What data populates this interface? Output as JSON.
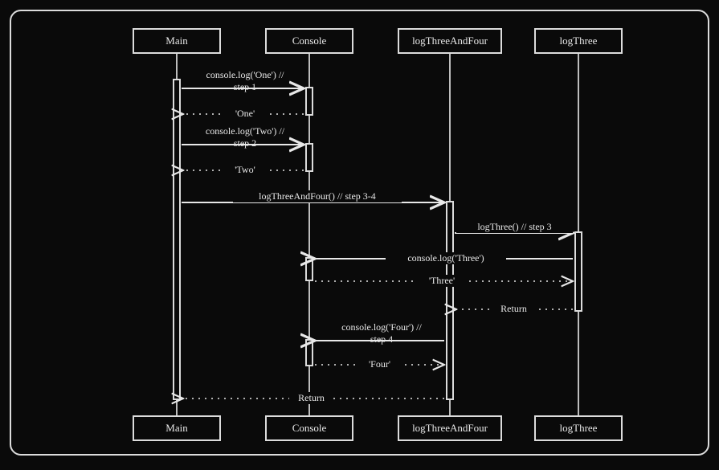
{
  "participants": {
    "p1": "Main",
    "p2": "Console",
    "p3": "logThreeAndFour",
    "p4": "logThree"
  },
  "messages": {
    "m1": "console.log('One') //\nstep 1",
    "r1": "'One'",
    "m2": "console.log('Two') //\nstep 2",
    "r2": "'Two'",
    "m3": "logThreeAndFour() // step 3-4",
    "m4": "logThree() // step 3",
    "m5": "console.log('Three')",
    "r5": "'Three'",
    "r6": "Return",
    "m7": "console.log('Four') //\nstep 4",
    "r7": "'Four'",
    "r8": "Return"
  }
}
